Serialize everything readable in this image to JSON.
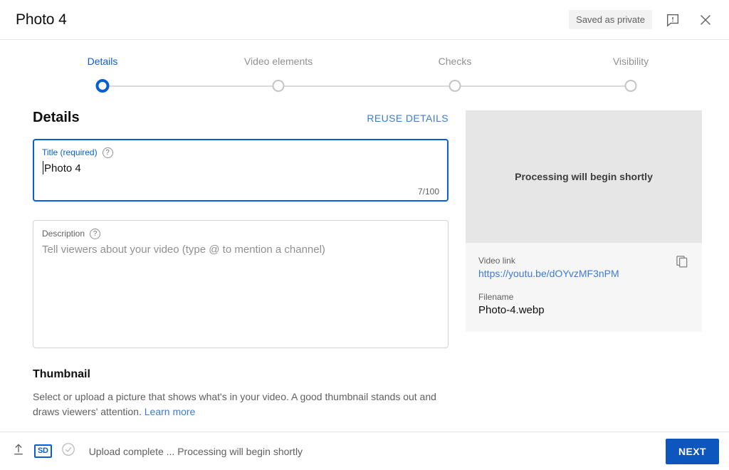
{
  "header": {
    "title": "Photo 4",
    "save_status": "Saved as private",
    "feedback_icon": "feedback-icon",
    "close_icon": "close-icon"
  },
  "stepper": {
    "steps": [
      {
        "label": "Details",
        "active": true
      },
      {
        "label": "Video elements",
        "active": false
      },
      {
        "label": "Checks",
        "active": false
      },
      {
        "label": "Visibility",
        "active": false
      }
    ]
  },
  "details": {
    "section_title": "Details",
    "reuse_label": "REUSE DETAILS",
    "title_field": {
      "label": "Title (required)",
      "value": "Photo 4",
      "char_count": "7/100",
      "help_icon": "help-icon"
    },
    "description_field": {
      "label": "Description",
      "placeholder": "Tell viewers about your video (type @ to mention a channel)",
      "help_icon": "help-icon"
    }
  },
  "thumbnail": {
    "title": "Thumbnail",
    "description_part1": "Select or upload a picture that shows what's in your video. A good thumbnail stands out and draws viewers' attention.",
    "learn_more": "Learn more"
  },
  "preview": {
    "processing_text": "Processing will begin shortly",
    "video_link_label": "Video link",
    "video_link": "https://youtu.be/dOYvzMF3nPM",
    "filename_label": "Filename",
    "filename": "Photo-4.webp",
    "copy_icon": "copy-icon"
  },
  "footer": {
    "upload_icon": "upload-icon",
    "quality_badge": "SD",
    "checks_icon": "check-circle-icon",
    "status_text": "Upload complete ... Processing will begin shortly",
    "next_label": "NEXT"
  },
  "colors": {
    "accent_blue": "#065fd4",
    "link_blue": "#3e7bd4",
    "next_button_blue": "#0d56bd",
    "panel_gray": "#f6f6f6",
    "preview_gray": "#e6e6e6"
  }
}
